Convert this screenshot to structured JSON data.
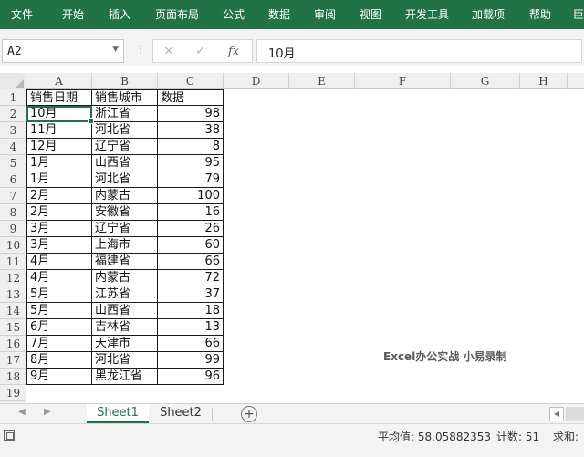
{
  "ribbon": {
    "tabs": [
      "文件",
      "开始",
      "插入",
      "页面布局",
      "公式",
      "数据",
      "审阅",
      "视图",
      "开发工具",
      "加载项",
      "帮助",
      "臣"
    ]
  },
  "formula_bar": {
    "name_box": "A2",
    "cancel_icon": "×",
    "enter_icon": "✓",
    "function_label": "fx",
    "formula_value": "10月"
  },
  "columns": [
    "A",
    "B",
    "C",
    "D",
    "E",
    "F",
    "G",
    "H"
  ],
  "rows": [
    "1",
    "2",
    "3",
    "4",
    "5",
    "6",
    "7",
    "8",
    "9",
    "10",
    "11",
    "12",
    "13",
    "14",
    "15",
    "16",
    "17",
    "18",
    "19"
  ],
  "table": {
    "headers": [
      "销售日期",
      "销售城市",
      "数据"
    ],
    "data": [
      [
        "10月",
        "浙江省",
        "98"
      ],
      [
        "11月",
        "河北省",
        "38"
      ],
      [
        "12月",
        "辽宁省",
        "8"
      ],
      [
        "1月",
        "山西省",
        "95"
      ],
      [
        "1月",
        "河北省",
        "79"
      ],
      [
        "2月",
        "内蒙古",
        "100"
      ],
      [
        "2月",
        "安徽省",
        "16"
      ],
      [
        "3月",
        "辽宁省",
        "26"
      ],
      [
        "3月",
        "上海市",
        "60"
      ],
      [
        "4月",
        "福建省",
        "66"
      ],
      [
        "4月",
        "内蒙古",
        "72"
      ],
      [
        "5月",
        "江苏省",
        "37"
      ],
      [
        "5月",
        "山西省",
        "18"
      ],
      [
        "6月",
        "吉林省",
        "13"
      ],
      [
        "7月",
        "天津市",
        "66"
      ],
      [
        "8月",
        "河北省",
        "99"
      ],
      [
        "9月",
        "黑龙江省",
        "96"
      ]
    ]
  },
  "watermark": "Excel办公实战 小易录制",
  "sheets": {
    "tabs": [
      "Sheet1",
      "Sheet2"
    ],
    "active": "Sheet1",
    "add_label": "+"
  },
  "status_bar": {
    "average": "平均值: 58.05882353",
    "count": "计数: 51",
    "sum": "求和:"
  },
  "colors": {
    "accent": "#217346",
    "ribbon_text": "#ffffff"
  }
}
